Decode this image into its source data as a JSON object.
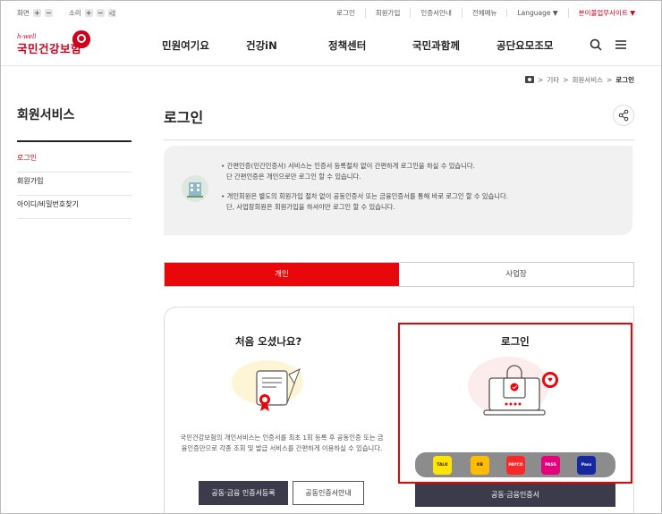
{
  "utility": {
    "screen_label": "화면",
    "sound_label": "소리",
    "plus": "+",
    "minus": "−",
    "links": [
      "로그인",
      "회원가입",
      "인증서안내",
      "전체메뉴"
    ],
    "language": "Language ▼",
    "related_site": "본이볼업무사이트 ▼"
  },
  "logo": {
    "sub": "h-well",
    "name": "국민건강보험"
  },
  "gnb": [
    "민원여기요",
    "건강iN",
    "정책센터",
    "국민과함께",
    "공단요모조모"
  ],
  "breadcrumb": {
    "items": [
      "기타",
      "회원서비스"
    ],
    "current": "로그인",
    "sep": ">"
  },
  "sidebar": {
    "title": "회원서비스",
    "items": [
      {
        "label": "로그인"
      },
      {
        "label": "회원가입"
      },
      {
        "label": "아이디/비밀번호찾기"
      }
    ]
  },
  "page": {
    "title": "로그인"
  },
  "info": {
    "lines": [
      "• 간편인증(민간인증서) 서비스는 인증서 등록절차 없이 간편하게 로그인을 하실 수 있습니다.",
      "단 간편인증은 개인으로만 로그인 할 수 있습니다.",
      "• 개인회원은 별도의 회원가입 절차 없이 공동인증서 또는 금융인증서를 통해 바로 로그인 할 수 있습니다.",
      "단, 사업장회원은 회원가입을 하셔야만 로그인 할 수 있습니다."
    ]
  },
  "tabs": [
    {
      "label": "개인",
      "active": true
    },
    {
      "label": "사업장",
      "active": false
    }
  ],
  "first_visit": {
    "title": "처음 오셨나요?",
    "desc": "국민건강보험의 개인서비스는 인증서를 최초 1회 등록 후 공동인증 또는 금융인증만으로 각종 조회 및 발급 서비스를 간편하게 이용하실 수 있습니다.",
    "btn_register": "공동·금융 인증서등록",
    "btn_guide": "공동인증서안내"
  },
  "login": {
    "title": "로그인",
    "certs": [
      {
        "name": "TALK",
        "icon": "kakao-icon",
        "bg": "#fee500",
        "fg": "#3b1e1e"
      },
      {
        "name": "KB",
        "icon": "kb-icon",
        "bg": "#ffbc00",
        "fg": "#222"
      },
      {
        "name": "PAYCO",
        "icon": "payco-icon",
        "bg": "#fa2828",
        "fg": "#fff"
      },
      {
        "name": "PASS",
        "icon": "pass-icon",
        "bg": "#e6007e",
        "fg": "#fff"
      },
      {
        "name": "Pass",
        "icon": "samsung-pass-icon",
        "bg": "#1428a0",
        "fg": "#fff"
      }
    ],
    "btn_login": "공동·금융인증서"
  },
  "colors": {
    "accent": "#e8070a",
    "brand": "#d0021b",
    "button_dark": "#3b3b4c"
  }
}
